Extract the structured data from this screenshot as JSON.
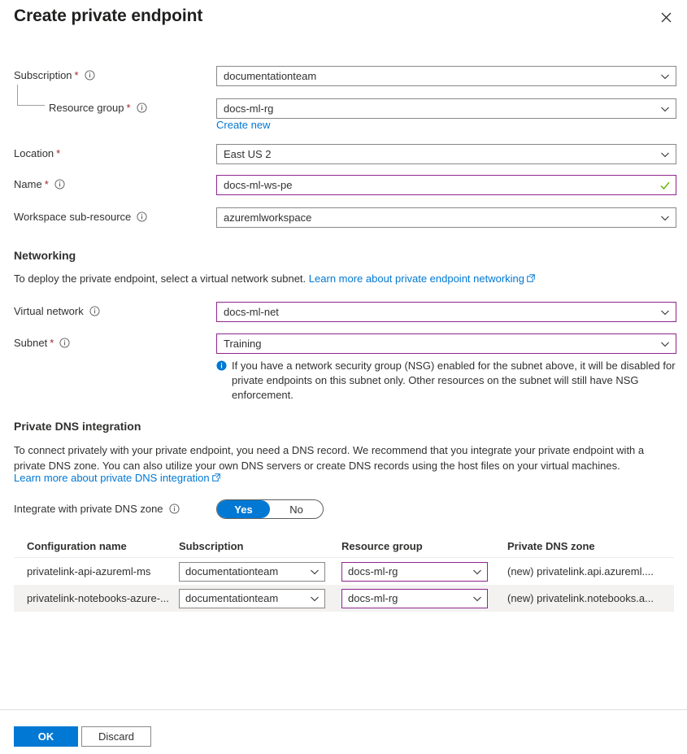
{
  "header": {
    "title": "Create private endpoint",
    "close_icon": "close-icon"
  },
  "fields": {
    "subscription": {
      "label": "Subscription",
      "required": true,
      "has_info": true,
      "value": "documentationteam"
    },
    "resource_group": {
      "label": "Resource group",
      "required": true,
      "has_info": true,
      "value": "docs-ml-rg",
      "create_new_link": "Create new"
    },
    "location": {
      "label": "Location",
      "required": true,
      "has_info": false,
      "value": "East US 2"
    },
    "name": {
      "label": "Name",
      "required": true,
      "has_info": true,
      "value": "docs-ml-ws-pe",
      "validated": true
    },
    "workspace_sub_resource": {
      "label": "Workspace sub-resource",
      "required": false,
      "has_info": true,
      "value": "azuremlworkspace"
    },
    "virtual_network": {
      "label": "Virtual network",
      "required": false,
      "has_info": true,
      "value": "docs-ml-net"
    },
    "subnet": {
      "label": "Subnet",
      "required": true,
      "has_info": true,
      "value": "Training"
    }
  },
  "networking": {
    "title": "Networking",
    "description": "To deploy the private endpoint, select a virtual network subnet.",
    "link_text": "Learn more about private endpoint networking",
    "subnet_note": "If you have a network security group (NSG) enabled for the subnet above, it will be disabled for private endpoints on this subnet only. Other resources on the subnet will still have NSG enforcement."
  },
  "private_dns": {
    "title": "Private DNS integration",
    "description_line1": "To connect privately with your private endpoint, you need a DNS record. We recommend that you integrate your private endpoint with a",
    "description_line2": "private DNS zone. You can also utilize your own DNS servers or create DNS records using the host files on your virtual machines.",
    "link_text": "Learn more about private DNS integration",
    "toggle_label": "Integrate with private DNS zone",
    "toggle_options": [
      "Yes",
      "No"
    ],
    "toggle_selected": "Yes"
  },
  "dns_table": {
    "columns": [
      "Configuration name",
      "Subscription",
      "Resource group",
      "Private DNS zone"
    ],
    "rows": [
      {
        "configuration_name": "privatelink-api-azureml-ms",
        "subscription": "documentationteam",
        "resource_group": "docs-ml-rg",
        "private_dns_zone": "(new) privatelink.api.azureml...."
      },
      {
        "configuration_name": "privatelink-notebooks-azure-...",
        "subscription": "documentationteam",
        "resource_group": "docs-ml-rg",
        "private_dns_zone": "(new) privatelink.notebooks.a..."
      }
    ]
  },
  "footer": {
    "ok_label": "OK",
    "discard_label": "Discard"
  },
  "colors": {
    "accent_blue": "#0078d4",
    "accent_purple": "#8f258f",
    "required_red": "#a4262c",
    "valid_green": "#498205"
  }
}
